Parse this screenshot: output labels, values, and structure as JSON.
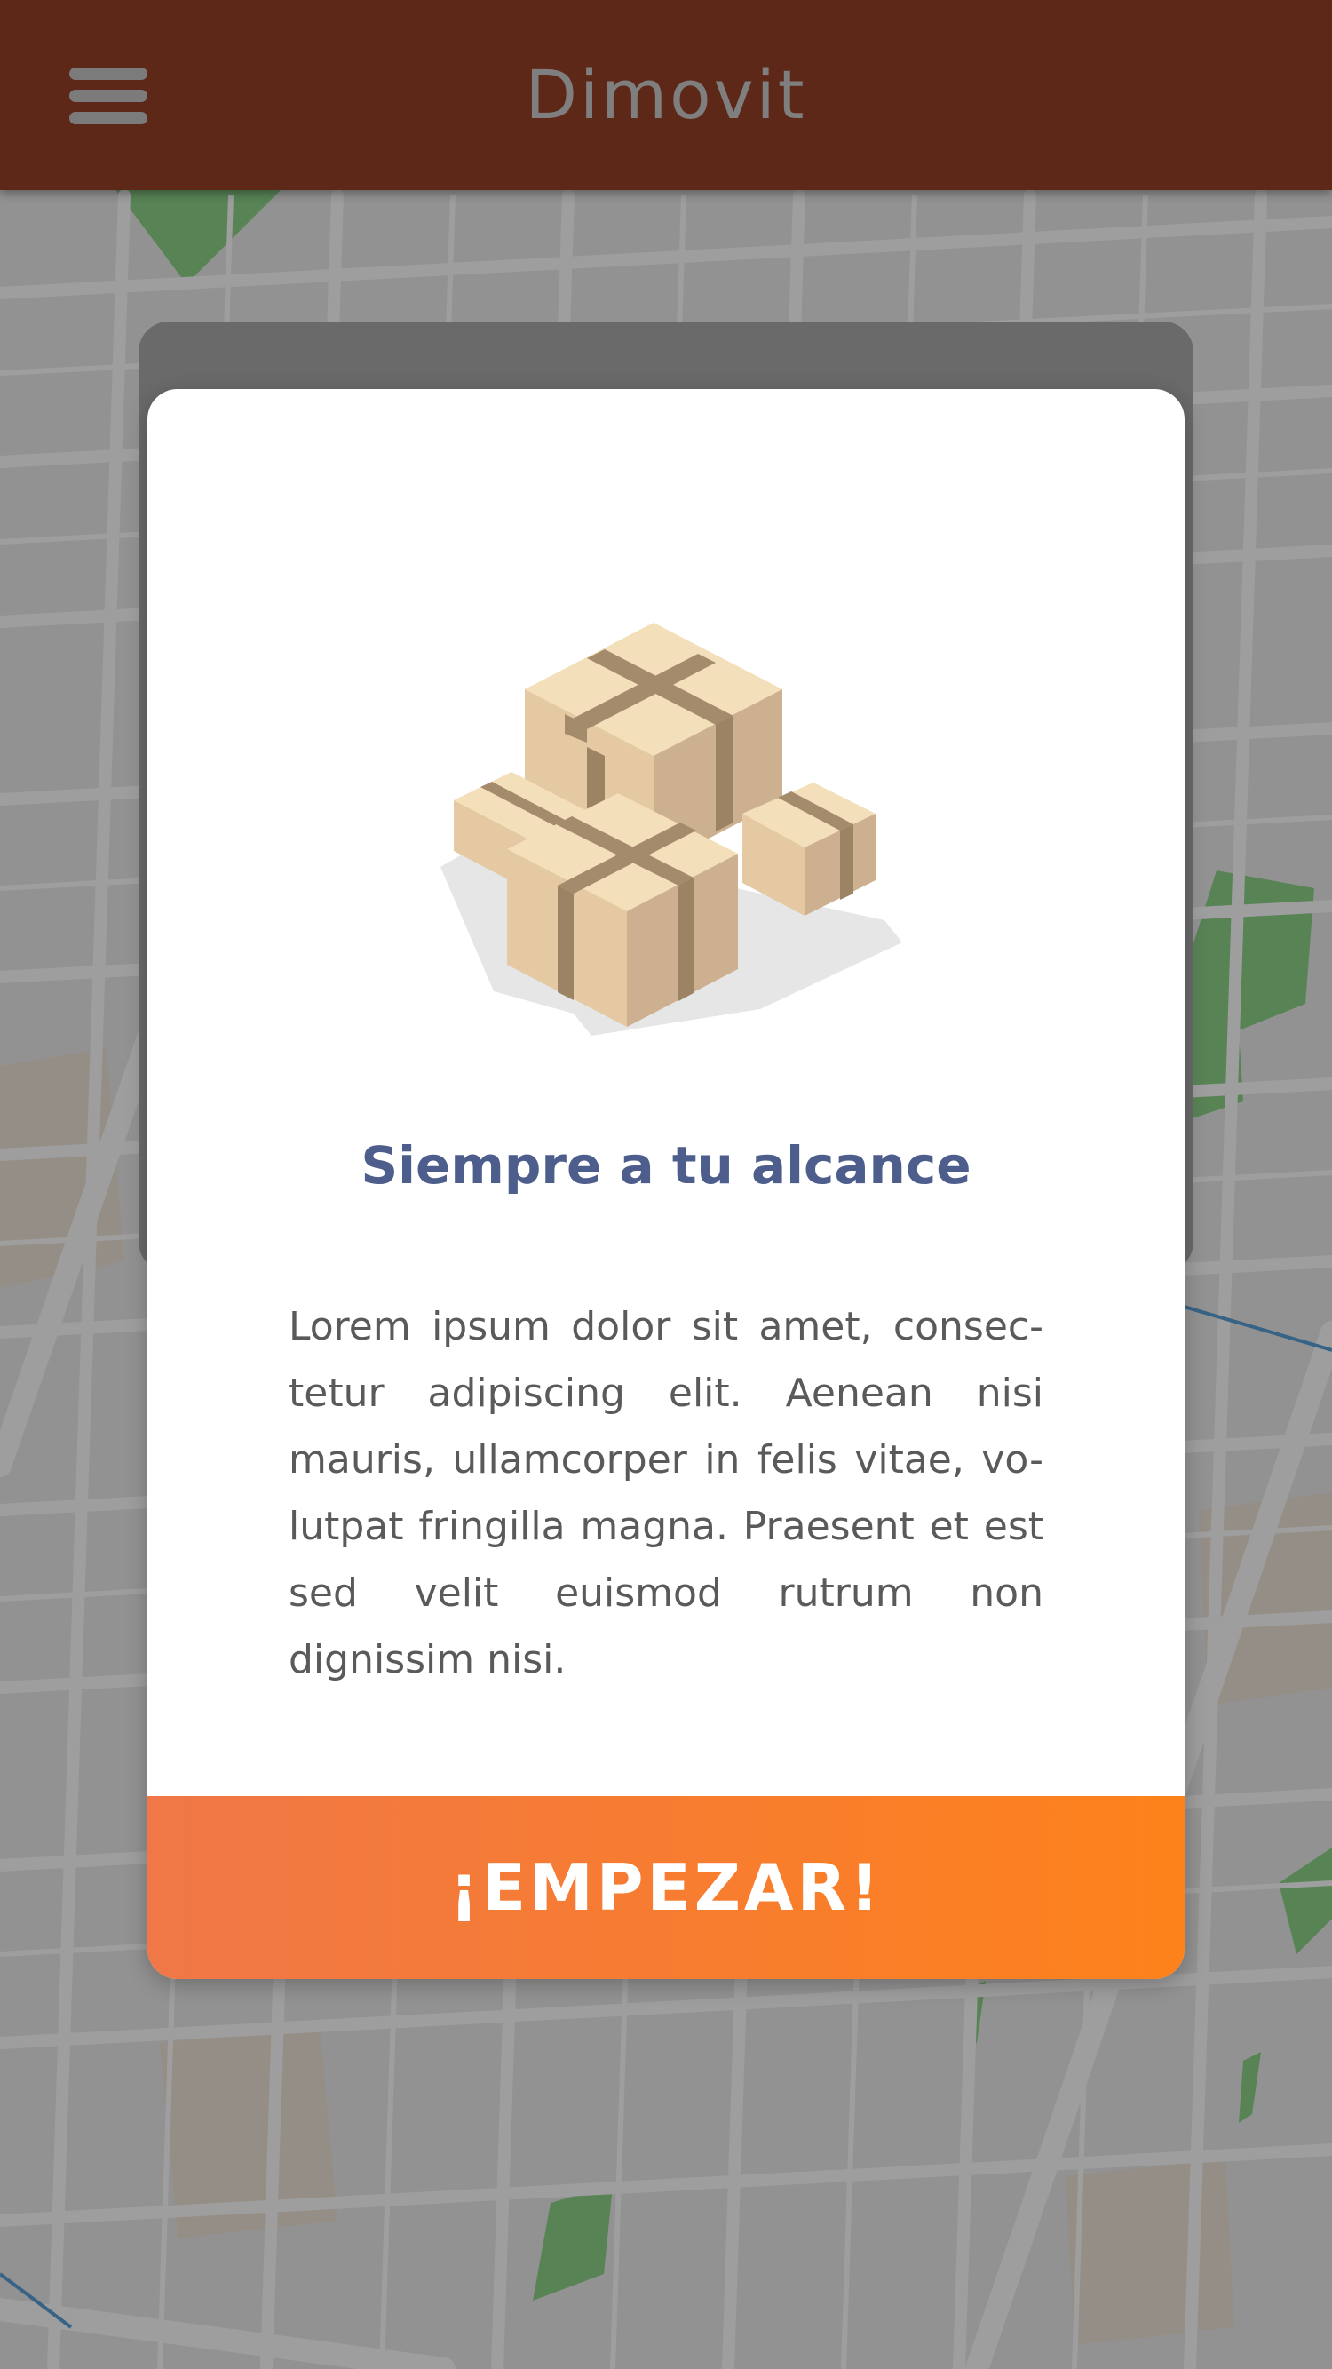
{
  "header": {
    "title": "Dimovit",
    "menu_icon": "hamburger-menu-icon"
  },
  "card": {
    "illustration_icon": "cardboard-boxes-icon",
    "title": "Siempre a tu alcance",
    "body": "Lorem ipsum dolor sit amet, consec-tetur adipiscing elit. Aenean nisi mauris, ullamcorper in felis vitae, vo-lutpat fringilla magna. Praesent et est sed velit euismod rutrum non dignissim nisi.",
    "button_label": "¡EMPEZAR!"
  },
  "colors": {
    "header_bg": "#5e2818",
    "title": "#4d5d8c",
    "button_start": "#f07747",
    "button_end": "#fe821b"
  }
}
